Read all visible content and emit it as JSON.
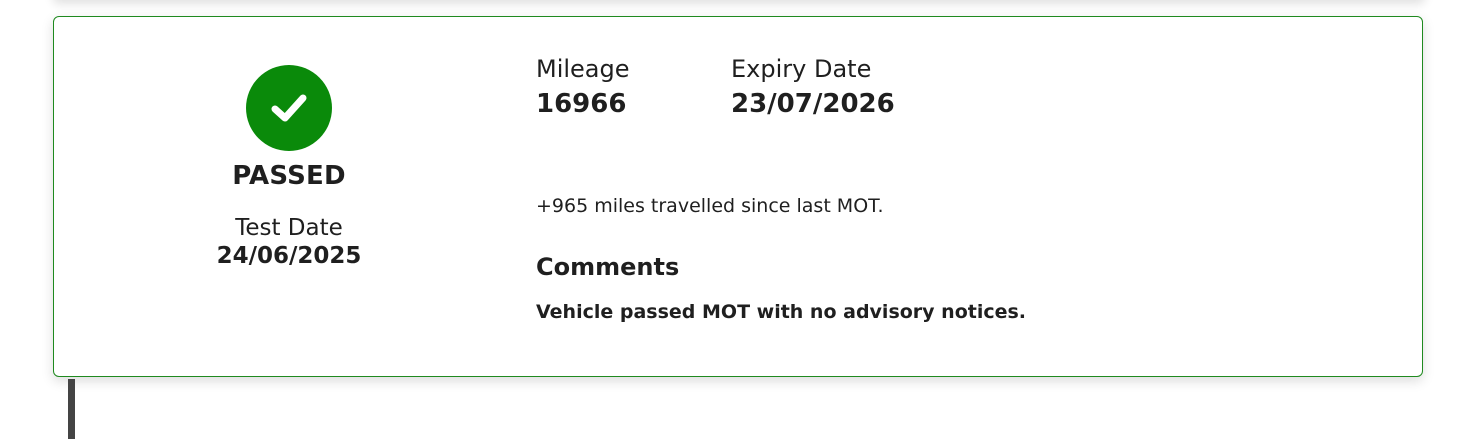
{
  "mot_record": {
    "status": "PASSED",
    "status_icon": "check-icon",
    "status_color": "#0a8a0a",
    "test_date_label": "Test Date",
    "test_date": "24/06/2025",
    "mileage_label": "Mileage",
    "mileage": "16966",
    "expiry_label": "Expiry Date",
    "expiry_date": "23/07/2026",
    "miles_note": "+965 miles travelled since last MOT.",
    "comments_heading": "Comments",
    "comments": "Vehicle passed MOT with no advisory notices."
  }
}
